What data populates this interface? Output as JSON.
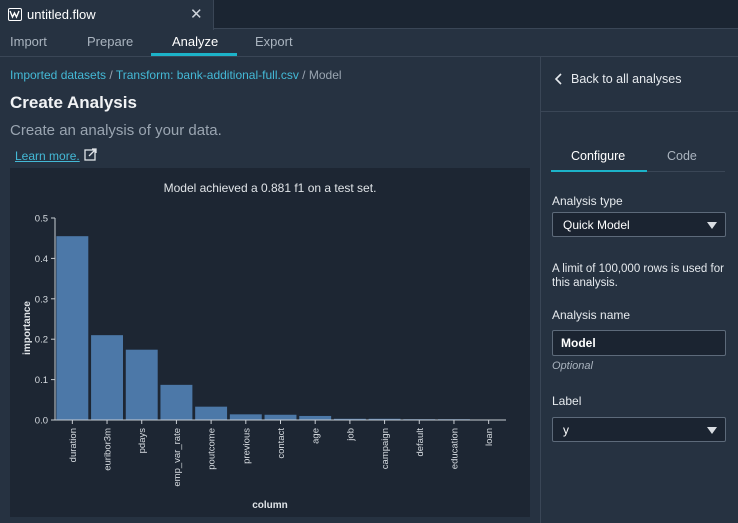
{
  "window": {
    "file_tab": "untitled.flow"
  },
  "nav_tabs": [
    {
      "label": "Import",
      "active": false
    },
    {
      "label": "Prepare",
      "active": false
    },
    {
      "label": "Analyze",
      "active": true
    },
    {
      "label": "Export",
      "active": false
    }
  ],
  "breadcrumb": {
    "item1": "Imported datasets",
    "sep": " / ",
    "item2": "Transform: bank-additional-full.csv",
    "item3": "Model"
  },
  "page": {
    "title": "Create Analysis",
    "subtitle": "Create an analysis of your data.",
    "learn_more": "Learn more."
  },
  "right_panel": {
    "back_label": "Back to all analyses",
    "tabs": [
      {
        "label": "Configure",
        "active": true
      },
      {
        "label": "Code",
        "active": false
      }
    ],
    "analysis_type_label": "Analysis type",
    "analysis_type_value": "Quick Model",
    "limit_note": "A limit of 100,000 rows is used for this analysis.",
    "analysis_name_label": "Analysis name",
    "analysis_name_value": "Model",
    "optional_text": "Optional",
    "label_label": "Label",
    "label_value": "y"
  },
  "colors": {
    "accent": "#1cb3c9",
    "link": "#44b9d6",
    "bar": "#4c78a8"
  },
  "chart_data": {
    "type": "bar",
    "title": "Model achieved a 0.881 f1 on a test set.",
    "xlabel": "column",
    "ylabel": "importance",
    "categories": [
      "duration",
      "euribor3m",
      "pdays",
      "emp_var_rate",
      "poutcome",
      "previous",
      "contact",
      "age",
      "job",
      "campaign",
      "default",
      "education",
      "loan"
    ],
    "values": [
      0.455,
      0.21,
      0.174,
      0.087,
      0.033,
      0.014,
      0.013,
      0.01,
      0.003,
      0.003,
      0.002,
      0.002,
      0.001
    ],
    "ylim": [
      0,
      0.5
    ],
    "yticks": [
      0,
      0.1,
      0.2,
      0.3,
      0.4,
      0.5
    ],
    "ytick_labels": [
      "0.0",
      "0.1",
      "0.2",
      "0.3",
      "0.4",
      "0.5"
    ],
    "grid": false,
    "legend": "none"
  }
}
